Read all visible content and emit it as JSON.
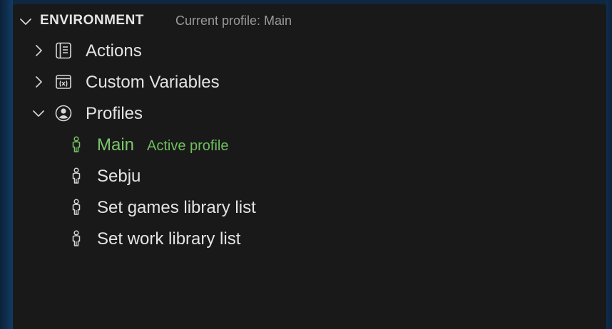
{
  "section": {
    "title": "ENVIRONMENT",
    "description": "Current profile: Main",
    "icon": "chevron-down-icon"
  },
  "tree": {
    "actions": {
      "label": "Actions",
      "icon": "book-icon",
      "expander": "chevron-right-icon"
    },
    "custom_variables": {
      "label": "Custom Variables",
      "icon": "variable-icon",
      "expander": "chevron-right-icon"
    },
    "profiles": {
      "label": "Profiles",
      "icon": "account-circle-icon",
      "expander": "chevron-down-icon",
      "items": [
        {
          "label": "Main",
          "description": "Active profile",
          "icon": "person-icon",
          "active": true
        },
        {
          "label": "Sebju",
          "description": "",
          "icon": "person-icon",
          "active": false
        },
        {
          "label": "Set games library list",
          "description": "",
          "icon": "person-icon",
          "active": false
        },
        {
          "label": "Set work library list",
          "description": "",
          "icon": "person-icon",
          "active": false
        }
      ]
    }
  },
  "colors": {
    "panel_background": "#191919",
    "active_green": "#7cc66a",
    "desktop_blue": "#0f2740"
  }
}
